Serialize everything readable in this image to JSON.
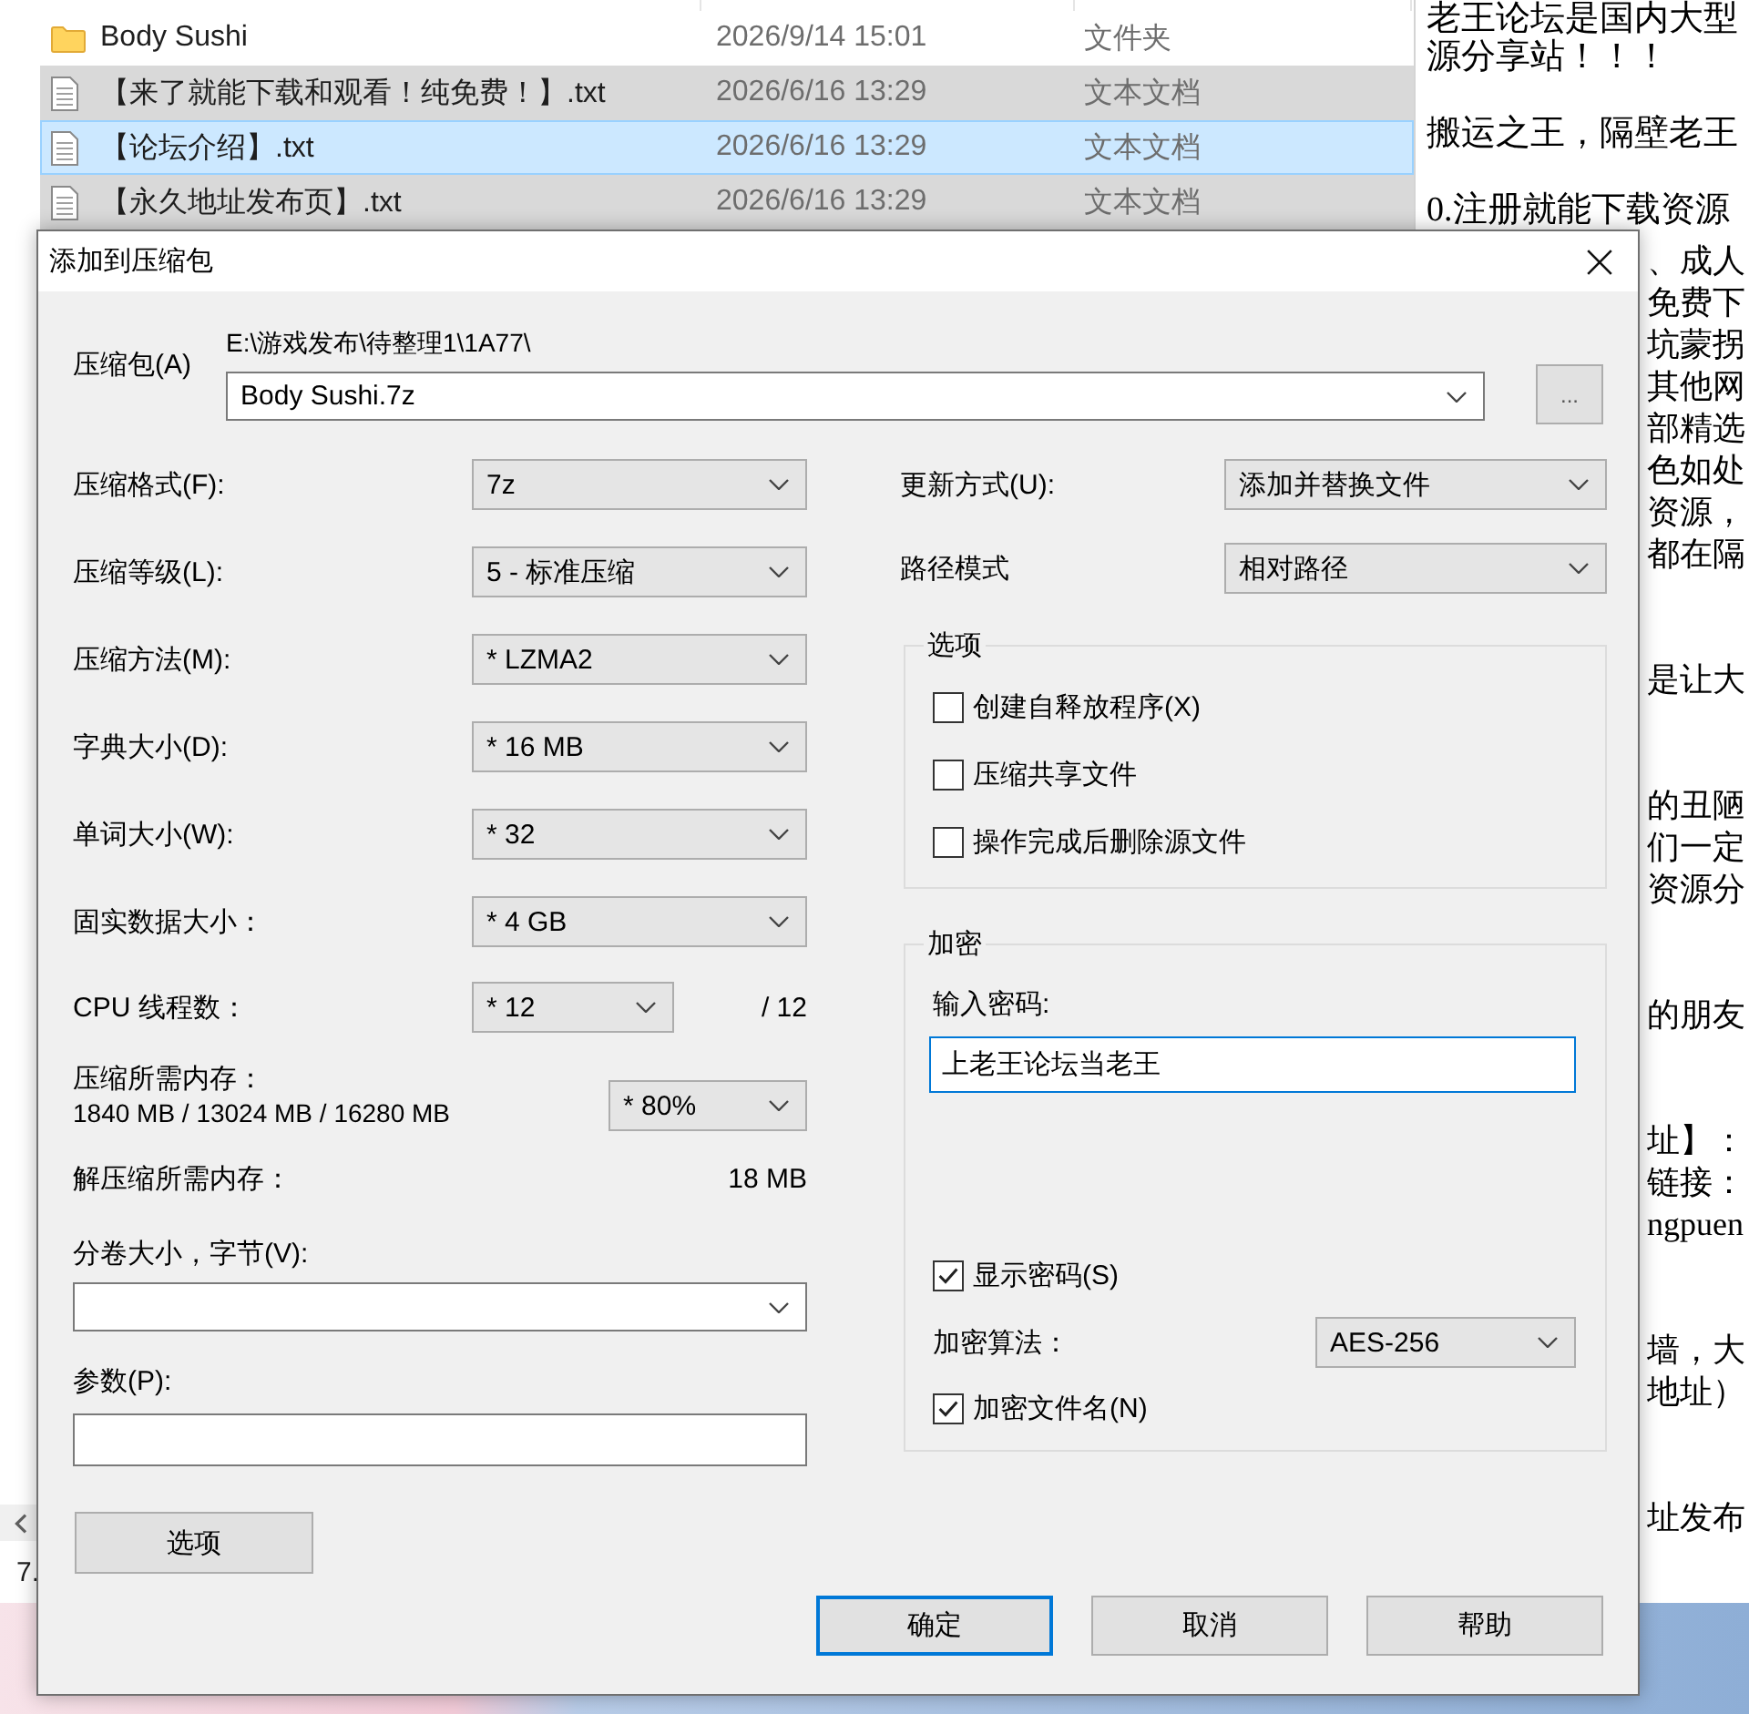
{
  "explorer": {
    "rows": [
      {
        "kind": "folder",
        "name": "Body Sushi",
        "date": "2026/9/14 15:01",
        "type": "文件夹",
        "selected": false,
        "focused": false
      },
      {
        "kind": "text",
        "name": "【来了就能下载和观看！纯免费！】.txt",
        "date": "2026/6/16 13:29",
        "type": "文本文档",
        "selected": true,
        "focused": false
      },
      {
        "kind": "text",
        "name": "【论坛介绍】.txt",
        "date": "2026/6/16 13:29",
        "type": "文本文档",
        "selected": true,
        "focused": true
      },
      {
        "kind": "text",
        "name": "【永久地址发布页】.txt",
        "date": "2026/6/16 13:29",
        "type": "文本文档",
        "selected": true,
        "focused": false
      }
    ],
    "status_bar": "7."
  },
  "notepad": {
    "paragraphs": [
      [
        "老王论坛是国内大型",
        "源分享站！！！"
      ],
      [
        "搬运之王，隔壁老王"
      ],
      [
        "0.注册就能下载资源"
      ]
    ],
    "line_ends": [
      [
        "、成人",
        "免费下",
        "坑蒙拐",
        "其他网",
        "部精选",
        "色如处",
        "资源，",
        "都在隔"
      ],
      [
        "是让大"
      ],
      [
        "的丑陋",
        "们一定",
        "资源分"
      ],
      [
        "的朋友"
      ],
      [
        "址】：",
        "链接：",
        "ngpuen"
      ],
      [
        "墙，大",
        "地址）"
      ],
      [
        "址发布"
      ]
    ]
  },
  "dialog": {
    "title": "添加到压缩包",
    "archive": {
      "label": "压缩包(A)",
      "folder": "E:\\游戏发布\\待整理1\\1A77\\",
      "value": "Body Sushi.7z",
      "browse": "..."
    },
    "settings": [
      {
        "label": "压缩格式(F):",
        "value": "7z"
      },
      {
        "label": "压缩等级(L):",
        "value": "5 - 标准压缩"
      },
      {
        "label": "压缩方法(M):",
        "value": "* LZMA2"
      },
      {
        "label": "字典大小(D):",
        "value": "* 16 MB"
      },
      {
        "label": "单词大小(W):",
        "value": "* 32"
      },
      {
        "label": "固实数据大小：",
        "value": "* 4 GB"
      }
    ],
    "threads": {
      "label": "CPU 线程数：",
      "value": "* 12",
      "total": "/ 12"
    },
    "memory": {
      "label": "压缩所需内存：",
      "usage": "1840 MB / 13024 MB / 16280 MB",
      "value": "* 80%"
    },
    "decompress_memory": {
      "label": "解压缩所需内存：",
      "value": "18 MB"
    },
    "volume_size": {
      "label": "分卷大小，字节(V):"
    },
    "parameters": {
      "label": "参数(P):"
    },
    "options_button": "选项",
    "update_mode": {
      "label": "更新方式(U):",
      "value": "添加并替换文件"
    },
    "path_mode": {
      "label": "路径模式",
      "value": "相对路径"
    },
    "options": {
      "title": "选项",
      "checkboxes": [
        {
          "label": "创建自释放程序(X)",
          "checked": false
        },
        {
          "label": "压缩共享文件",
          "checked": false
        },
        {
          "label": "操作完成后删除源文件",
          "checked": false
        }
      ]
    },
    "encryption": {
      "title": "加密",
      "password_label": "输入密码:",
      "password": {
        "value": "上老王论坛当老王",
        "focused": true
      },
      "show_password": {
        "label": "显示密码(S)",
        "checked": true
      },
      "method_label": "加密算法：",
      "method": "AES-256",
      "encrypt_names": {
        "label": "加密文件名(N)",
        "checked": true
      }
    },
    "buttons": [
      {
        "label": "确定",
        "default": true
      },
      {
        "label": "取消",
        "default": false
      },
      {
        "label": "帮助",
        "default": false
      }
    ]
  }
}
